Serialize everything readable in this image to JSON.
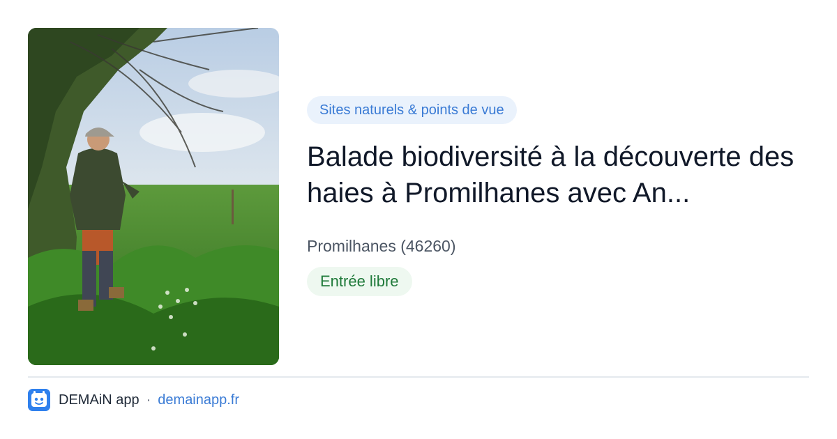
{
  "event": {
    "category": "Sites naturels & points de vue",
    "title": "Balade biodiversité à la découverte des haies à Promilhanes avec An...",
    "location": "Promilhanes (46260)",
    "price": "Entrée libre"
  },
  "footer": {
    "app_name": "DEMAiN app",
    "separator": "·",
    "url": "demainapp.fr",
    "icon": "demain-app-logo-icon"
  },
  "colors": {
    "accent": "#3a7bd5",
    "category_bg": "#eaf2fc",
    "price_text": "#1f7a3a",
    "price_bg": "#eef8f0"
  }
}
